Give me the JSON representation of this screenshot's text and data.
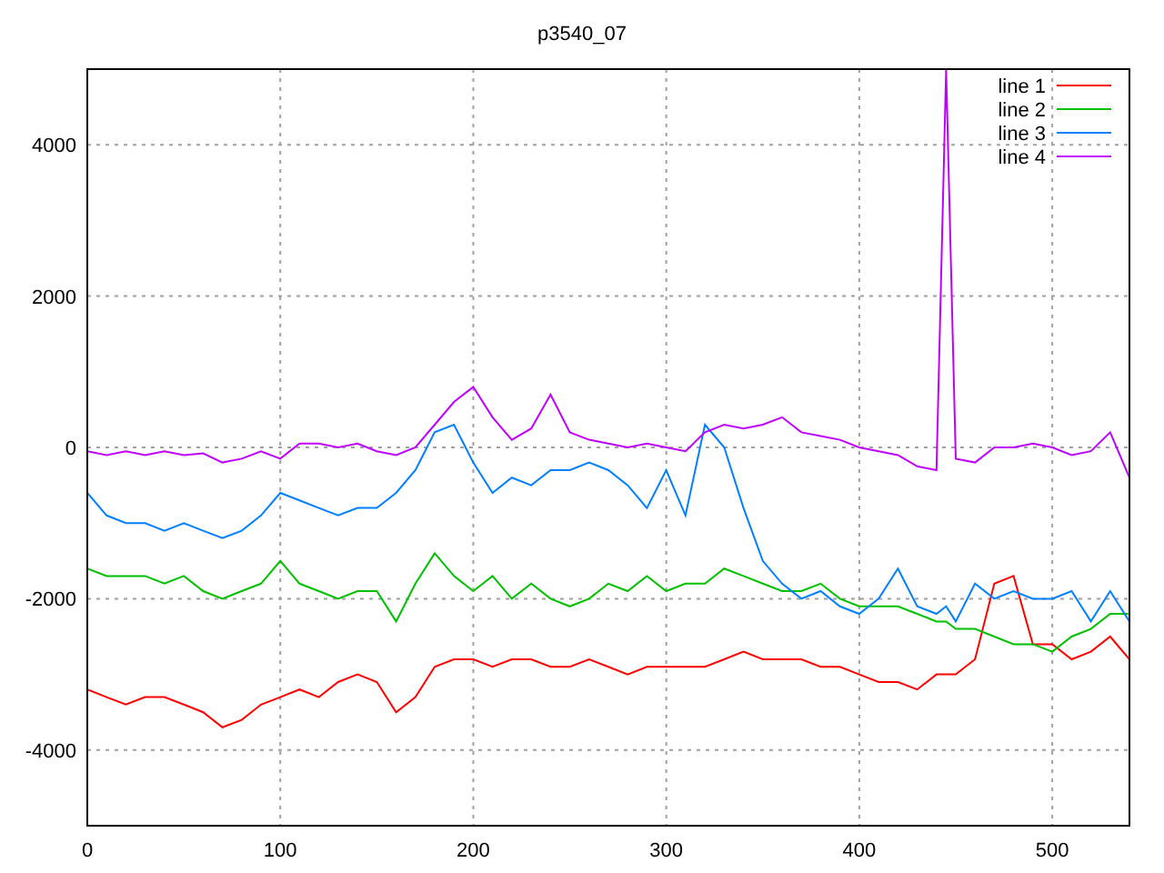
{
  "chart": {
    "chart_data": {
      "type": "line",
      "title": "p3540_07",
      "x": [
        0,
        10,
        20,
        30,
        40,
        50,
        60,
        70,
        80,
        90,
        100,
        110,
        120,
        130,
        140,
        150,
        160,
        170,
        180,
        190,
        200,
        210,
        220,
        230,
        240,
        250,
        260,
        270,
        280,
        290,
        300,
        310,
        320,
        330,
        340,
        350,
        360,
        370,
        380,
        390,
        400,
        410,
        420,
        430,
        440,
        445,
        450,
        460,
        470,
        480,
        490,
        500,
        510,
        520,
        530,
        540
      ],
      "series": [
        {
          "name": "line 1",
          "color": "#ff0000",
          "values": [
            -3200,
            -3300,
            -3400,
            -3300,
            -3300,
            -3400,
            -3500,
            -3700,
            -3600,
            -3400,
            -3300,
            -3200,
            -3300,
            -3100,
            -3000,
            -3100,
            -3500,
            -3300,
            -2900,
            -2800,
            -2800,
            -2900,
            -2800,
            -2800,
            -2900,
            -2900,
            -2800,
            -2900,
            -3000,
            -2900,
            -2900,
            -2900,
            -2900,
            -2800,
            -2700,
            -2800,
            -2800,
            -2800,
            -2900,
            -2900,
            -3000,
            -3100,
            -3100,
            -3200,
            -3000,
            -3000,
            -3000,
            -2800,
            -1800,
            -1700,
            -2600,
            -2600,
            -2800,
            -2700,
            -2500,
            -2800
          ]
        },
        {
          "name": "line 2",
          "color": "#00c000",
          "values": [
            -1600,
            -1700,
            -1700,
            -1700,
            -1800,
            -1700,
            -1900,
            -2000,
            -1900,
            -1800,
            -1500,
            -1800,
            -1900,
            -2000,
            -1900,
            -1900,
            -2300,
            -1800,
            -1400,
            -1700,
            -1900,
            -1700,
            -2000,
            -1800,
            -2000,
            -2100,
            -2000,
            -1800,
            -1900,
            -1700,
            -1900,
            -1800,
            -1800,
            -1600,
            -1700,
            -1800,
            -1900,
            -1900,
            -1800,
            -2000,
            -2100,
            -2100,
            -2100,
            -2200,
            -2300,
            -2300,
            -2400,
            -2400,
            -2500,
            -2600,
            -2600,
            -2700,
            -2500,
            -2400,
            -2200,
            -2200
          ]
        },
        {
          "name": "line 3",
          "color": "#0080ff",
          "values": [
            -600,
            -900,
            -1000,
            -1000,
            -1100,
            -1000,
            -1100,
            -1200,
            -1100,
            -900,
            -600,
            -700,
            -800,
            -900,
            -800,
            -800,
            -600,
            -300,
            200,
            300,
            -200,
            -600,
            -400,
            -500,
            -300,
            -300,
            -200,
            -300,
            -500,
            -800,
            -300,
            -900,
            300,
            0,
            -800,
            -1500,
            -1800,
            -2000,
            -1900,
            -2100,
            -2200,
            -2000,
            -1600,
            -2100,
            -2200,
            -2100,
            -2300,
            -1800,
            -2000,
            -1900,
            -2000,
            -2000,
            -1900,
            -2300,
            -1900,
            -2300
          ]
        },
        {
          "name": "line 4",
          "color": "#c000ff",
          "values": [
            -50,
            -100,
            -50,
            -100,
            -50,
            -100,
            -80,
            -200,
            -150,
            -50,
            -150,
            50,
            50,
            0,
            50,
            -50,
            -100,
            0,
            300,
            600,
            800,
            400,
            100,
            250,
            700,
            200,
            100,
            50,
            0,
            50,
            0,
            -50,
            200,
            300,
            250,
            300,
            400,
            200,
            150,
            100,
            0,
            -50,
            -100,
            -250,
            -300,
            5000,
            -150,
            -200,
            0,
            0,
            50,
            0,
            -100,
            -50,
            200,
            -400
          ]
        }
      ],
      "xlim": [
        0,
        540
      ],
      "ylim": [
        -5000,
        5000
      ],
      "xticks": [
        0,
        100,
        200,
        300,
        400,
        500
      ],
      "yticks": [
        -4000,
        -2000,
        0,
        2000,
        4000
      ],
      "grid": true,
      "legend": true
    }
  }
}
